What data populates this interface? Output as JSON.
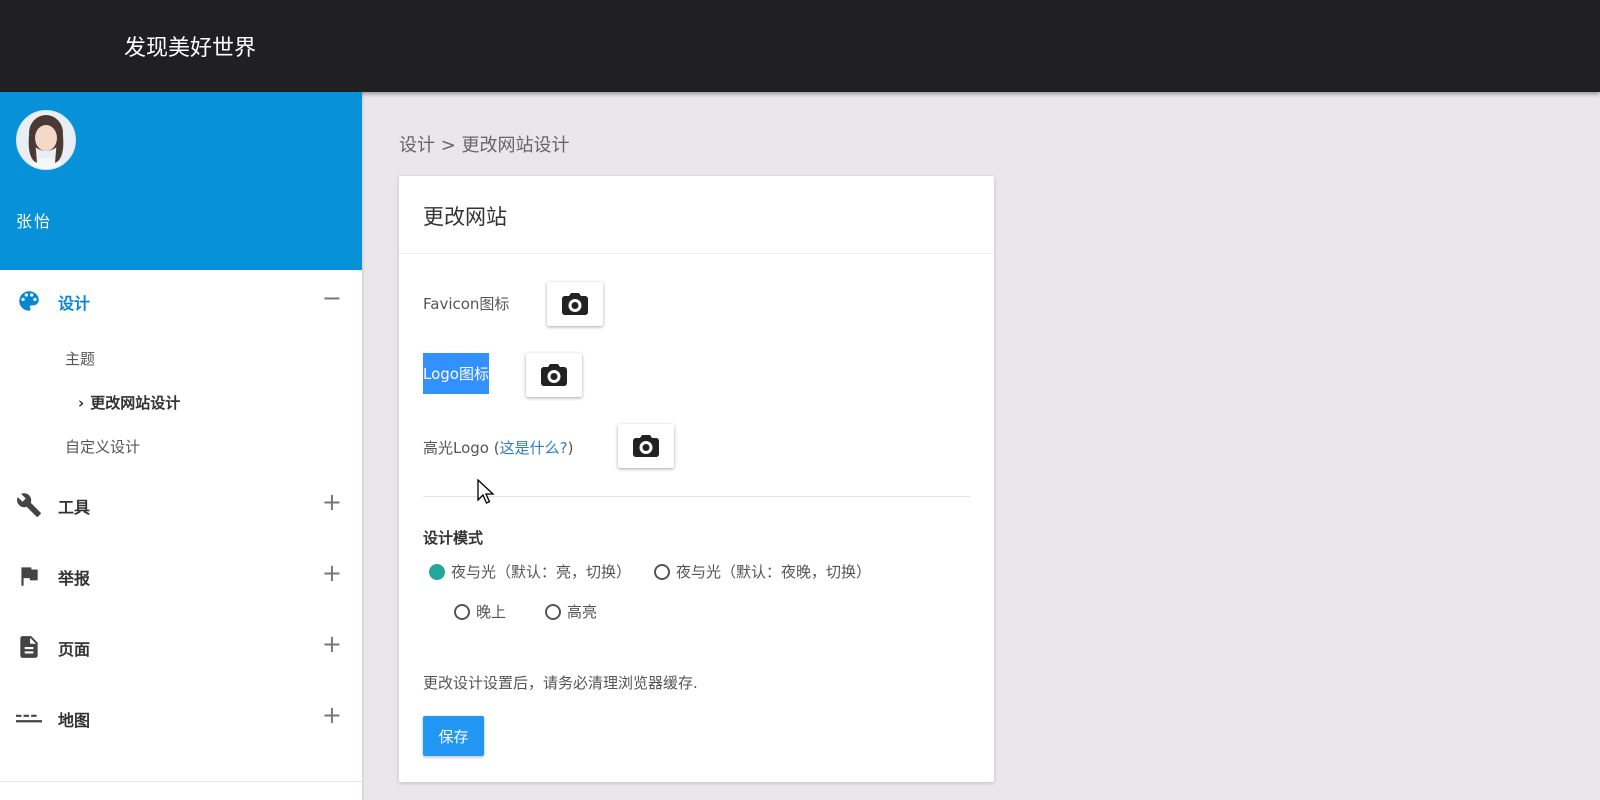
{
  "header": {
    "site_title": "发现美好世界"
  },
  "sidebar": {
    "user_name": "张怡",
    "nav": [
      {
        "label": "设计",
        "icon": "palette-icon",
        "toggle": "−",
        "expanded": true
      },
      {
        "label": "工具",
        "icon": "wrench-icon",
        "toggle": "+"
      },
      {
        "label": "举报",
        "icon": "flag-icon",
        "toggle": "+"
      },
      {
        "label": "页面",
        "icon": "document-icon",
        "toggle": "+"
      },
      {
        "label": "地图",
        "icon": "map-icon",
        "toggle": "+"
      }
    ],
    "design_sub": [
      "主题",
      "更改网站设计",
      "自定义设计"
    ],
    "current_marker": "›"
  },
  "breadcrumb": "设计 > 更改网站设计",
  "card": {
    "title": "更改网站",
    "favicon_label": "Favicon图标",
    "logo_label": "Logo图标",
    "highlight_logo_label": "高光Logo (",
    "help_link": "这是什么?",
    "help_close": ")",
    "mode_title": "设计模式",
    "modes": [
      {
        "label": "夜与光（默认：亮，切换）",
        "checked": true
      },
      {
        "label": "夜与光（默认：夜晚，切换）",
        "checked": false
      },
      {
        "label": "晚上",
        "checked": false
      },
      {
        "label": "高亮",
        "checked": false
      }
    ],
    "note": "更改设计设置后，请务必清理浏览器缓存.",
    "save_label": "保存"
  },
  "colors": {
    "topbar": "#202022",
    "sidebar_accent": "#0691d8",
    "radio_checked": "#26a69a",
    "primary_button": "#2196f3"
  }
}
